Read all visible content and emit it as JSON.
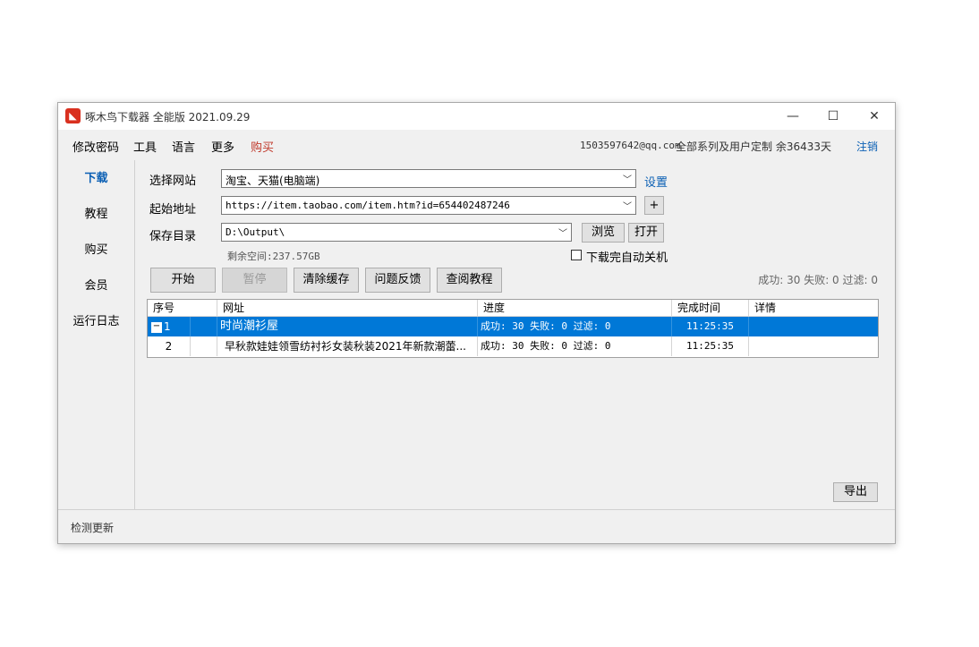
{
  "window": {
    "title": "啄木鸟下载器 全能版 2021.09.29",
    "logo_icon": "woodpecker-logo",
    "minimize_glyph": "—",
    "maximize_glyph": "☐",
    "close_glyph": "✕"
  },
  "menubar": {
    "items": [
      "修改密码",
      "工具",
      "语言",
      "更多",
      "购买"
    ],
    "email": "1503597642@qq.com",
    "account_info": "全部系列及用户定制 余36433天",
    "logout": "注销"
  },
  "sidebar": {
    "items": [
      "下载",
      "教程",
      "购买",
      "会员",
      "运行日志"
    ],
    "active": "下载"
  },
  "form": {
    "site_label": "选择网站",
    "site_value": "淘宝、天猫(电脑端)",
    "settings_link": "设置",
    "url_label": "起始地址",
    "url_value": "https://item.taobao.com/item.htm?id=654402487246",
    "plus_label": "+",
    "dir_label": "保存目录",
    "dir_value": "D:\\Output\\",
    "browse_label": "浏览",
    "open_label": "打开",
    "free_space": "剩余空间:237.57GB",
    "auto_shutdown_label": "下载完自动关机",
    "auto_shutdown_checked": false
  },
  "actions": {
    "start": "开始",
    "pause": "暂停",
    "clear_cache": "清除缓存",
    "feedback": "问题反馈",
    "tutorial": "查阅教程",
    "summary": "成功: 30 失败: 0 过滤: 0"
  },
  "table": {
    "columns": [
      "序号",
      "网址",
      "进度",
      "完成时间",
      "详情"
    ],
    "rows": [
      {
        "index": "1",
        "expander": "−",
        "url": "时尚潮衫屋",
        "progress": "成功: 30 失败: 0 过滤: 0",
        "time": "11:25:35",
        "detail": "",
        "selected": true
      },
      {
        "index": "2",
        "expander": "",
        "url": "早秋款娃娃领雪纺衬衫女装秋装2021年新款潮蕾...",
        "progress": "成功: 30 失败: 0 过滤: 0",
        "time": "11:25:35",
        "detail": "",
        "selected": false
      }
    ]
  },
  "export_label": "导出",
  "status": {
    "check_update": "检测更新"
  },
  "colors": {
    "accent": "#0078d7",
    "link": "#0a5fb4",
    "buy": "#c0392b",
    "logo": "#d9301f"
  }
}
